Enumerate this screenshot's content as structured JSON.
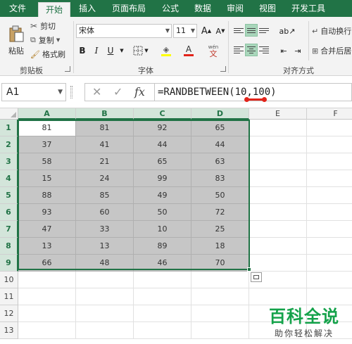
{
  "menu": {
    "file": "文件",
    "tabs": [
      "开始",
      "插入",
      "页面布局",
      "公式",
      "数据",
      "审阅",
      "视图",
      "开发工具"
    ]
  },
  "ribbon": {
    "clipboard": {
      "paste": "粘贴",
      "cut": "剪切",
      "copy": "复制",
      "format_painter": "格式刷",
      "group": "剪贴板"
    },
    "font": {
      "name": "宋体",
      "size": "11",
      "grow": "A",
      "shrink": "A",
      "bold": "B",
      "italic": "I",
      "underline": "U",
      "font_color": "A",
      "wen": "wén",
      "group": "字体"
    },
    "alignment": {
      "wrap": "自动换行",
      "merge": "合并后居",
      "group": "对齐方式"
    }
  },
  "formula_bar": {
    "name_box": "A1",
    "cancel": "✕",
    "enter": "✓",
    "fx": "fx",
    "formula": "=RANDBETWEEN(10,100)"
  },
  "grid": {
    "columns": [
      "A",
      "B",
      "C",
      "D",
      "E",
      "F"
    ],
    "rows": [
      "1",
      "2",
      "3",
      "4",
      "5",
      "6",
      "7",
      "8",
      "9",
      "10",
      "11",
      "12",
      "13"
    ],
    "data": [
      [
        "81",
        "81",
        "92",
        "65"
      ],
      [
        "37",
        "41",
        "44",
        "44"
      ],
      [
        "58",
        "21",
        "65",
        "63"
      ],
      [
        "15",
        "24",
        "99",
        "83"
      ],
      [
        "88",
        "85",
        "49",
        "50"
      ],
      [
        "93",
        "60",
        "50",
        "72"
      ],
      [
        "47",
        "33",
        "10",
        "25"
      ],
      [
        "13",
        "13",
        "89",
        "18"
      ],
      [
        "66",
        "48",
        "46",
        "70"
      ]
    ]
  },
  "watermark": {
    "title": "百科全说",
    "subtitle": "助你轻松解决"
  },
  "colors": {
    "excel_green": "#217346",
    "selection_gray": "#c6c6c6",
    "watermark_green": "#14a24a"
  }
}
